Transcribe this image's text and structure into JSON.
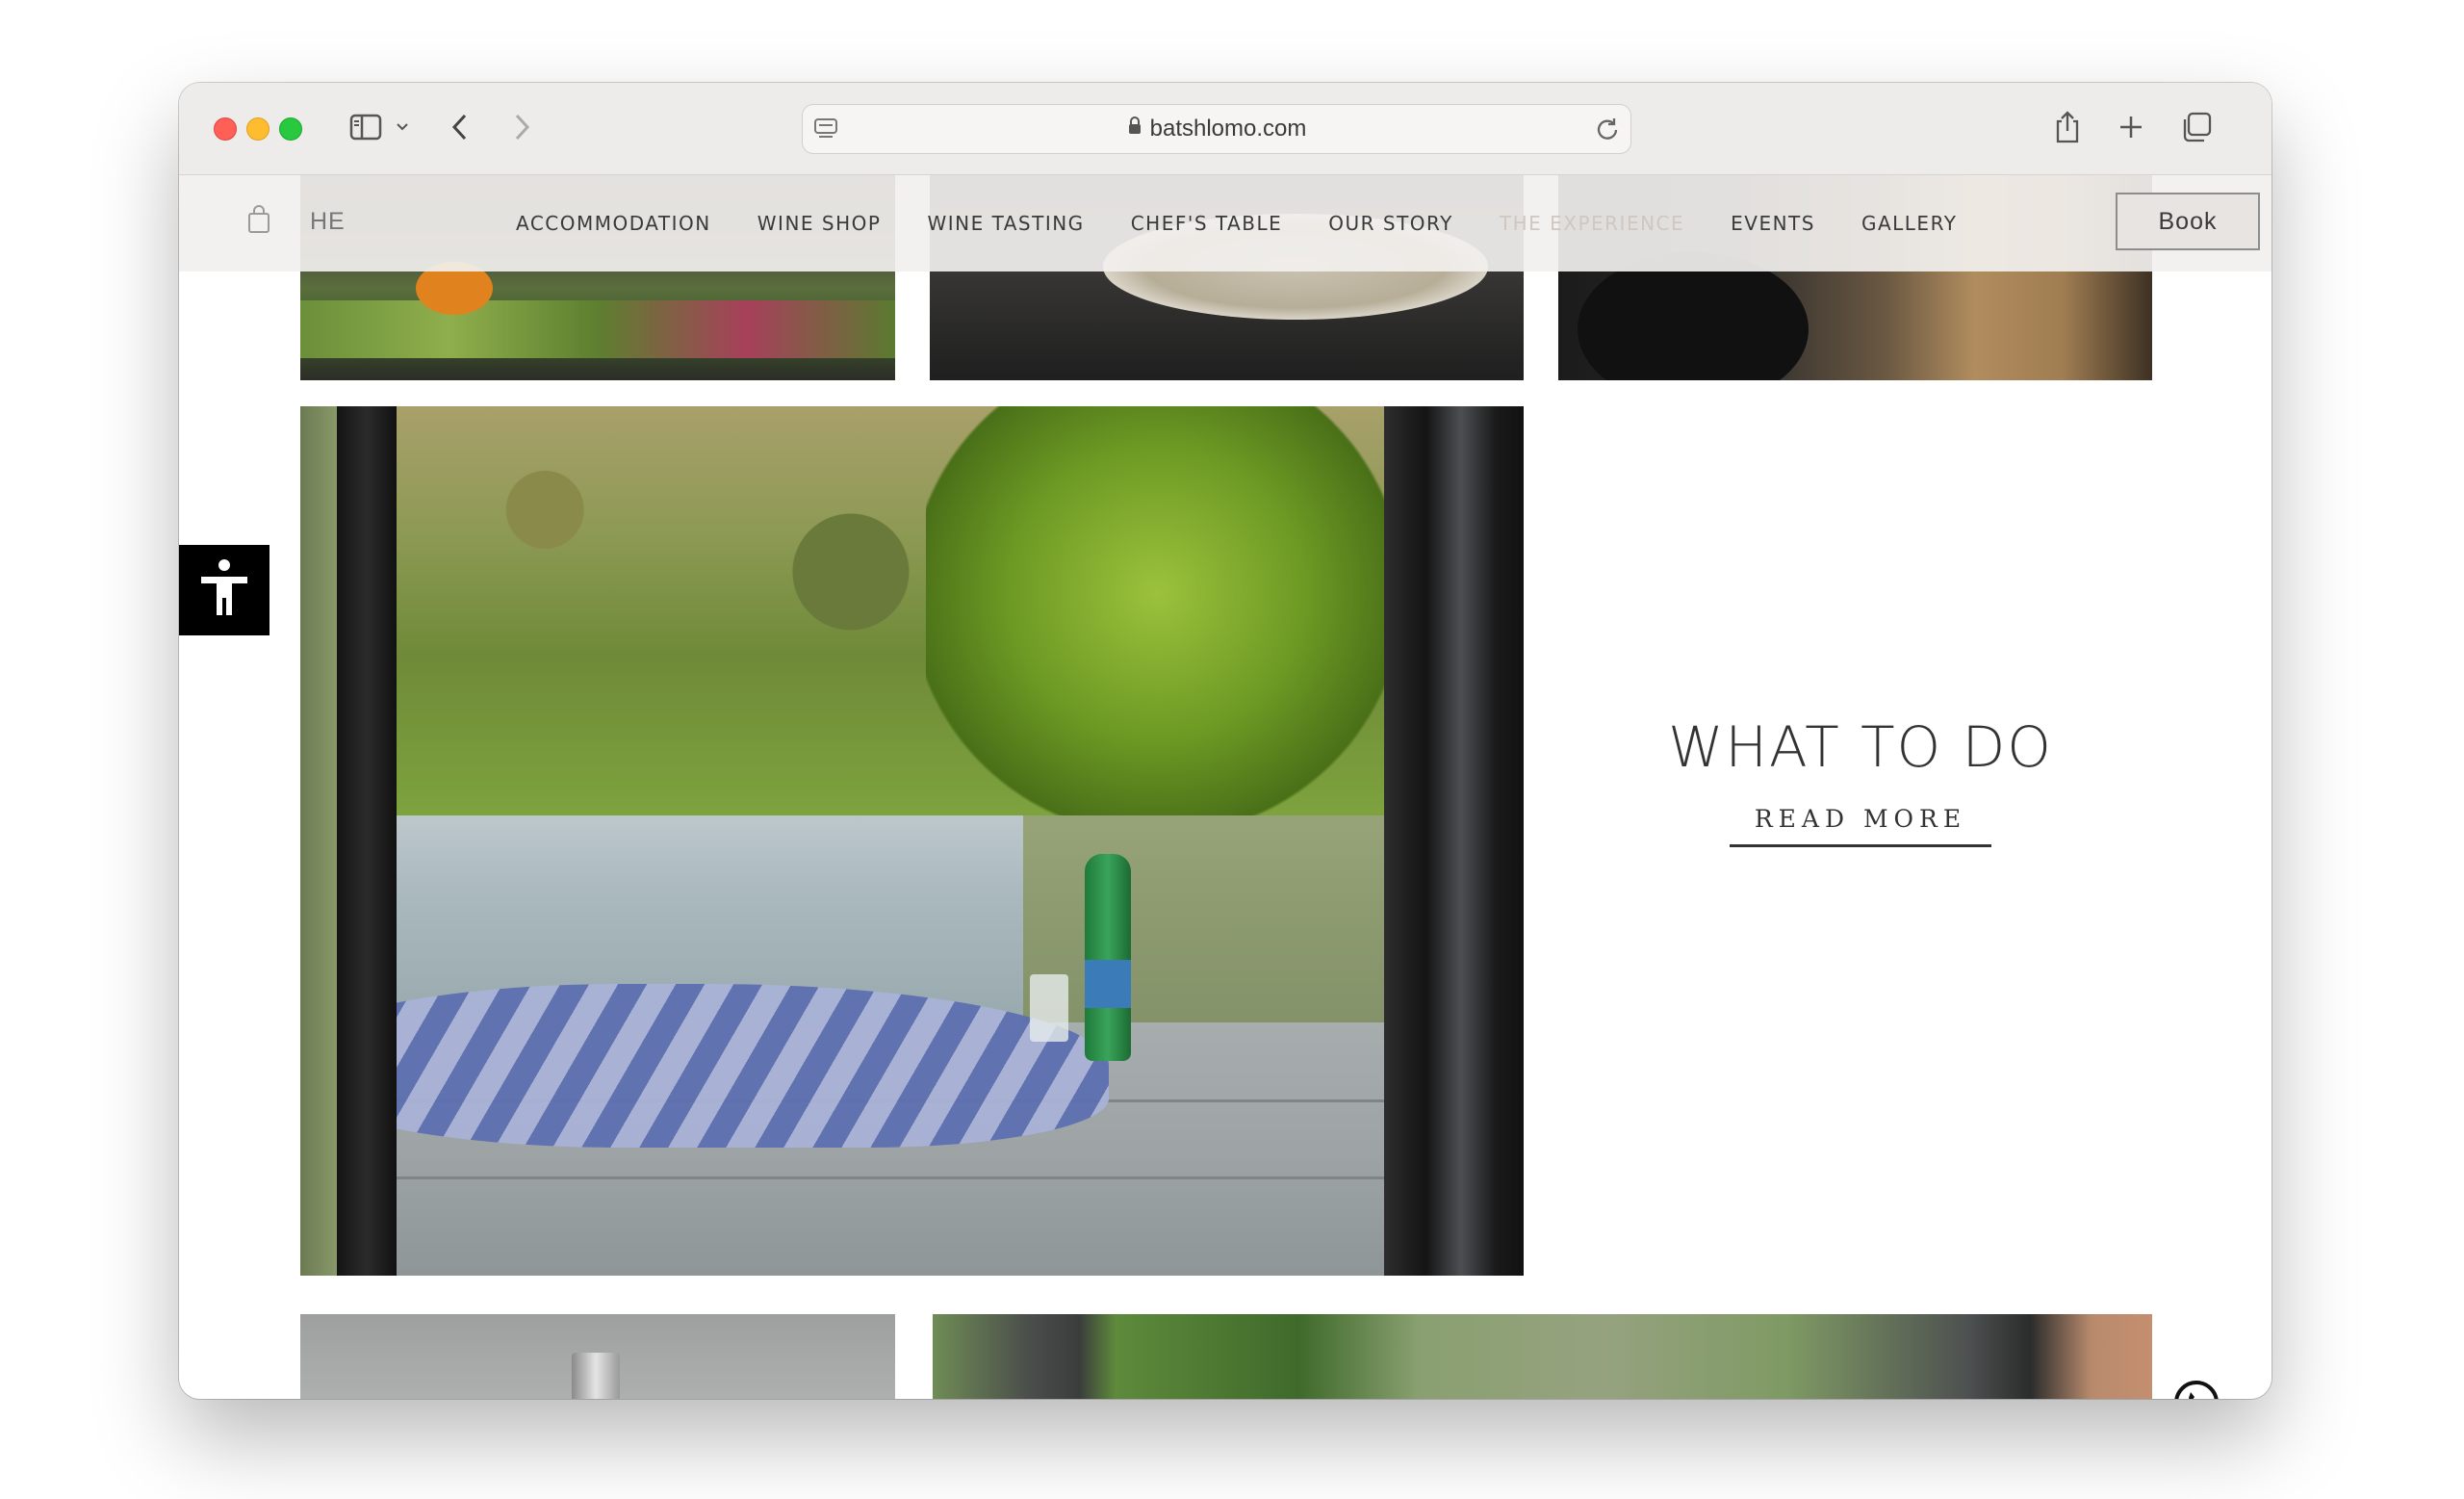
{
  "browser": {
    "url": "batshlomo.com"
  },
  "nav": {
    "lang": "HE",
    "links": [
      {
        "label": "ACCOMMODATION"
      },
      {
        "label": "WINE SHOP"
      },
      {
        "label": "WINE TASTING"
      },
      {
        "label": "CHEF'S TABLE"
      },
      {
        "label": "OUR STORY"
      },
      {
        "label": "THE EXPERIENCE"
      },
      {
        "label": "EVENTS"
      },
      {
        "label": "GALLERY"
      }
    ],
    "book_label": "Book"
  },
  "section": {
    "title": "WHAT TO DO",
    "cta": "READ MORE"
  },
  "icons": {
    "cart": "shopping-bag-icon",
    "accessibility": "accessibility-icon",
    "chat": "whatsapp-chat-icon"
  },
  "colors": {
    "accent_dark": "#333333",
    "nav_bg": "#f2f0ee",
    "muted_nav": "#cfc7c0"
  }
}
